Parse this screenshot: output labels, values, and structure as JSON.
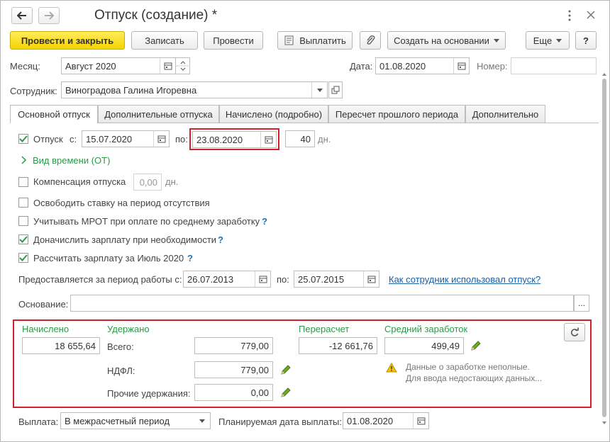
{
  "window": {
    "title": "Отпуск (создание) *",
    "more_icon": "vertical-dots-icon",
    "close_icon": "close-icon"
  },
  "toolbar": {
    "post_close": "Провести и закрыть",
    "save": "Записать",
    "post": "Провести",
    "pay": "Выплатить",
    "create_based": "Создать на основании",
    "more": "Еще",
    "help": "?"
  },
  "header": {
    "month_label": "Месяц:",
    "month_value": "Август 2020",
    "date_label": "Дата:",
    "date_value": "01.08.2020",
    "number_label": "Номер:",
    "number_value": "",
    "employee_label": "Сотрудник:",
    "employee_value": "Виноградова Галина Игоревна"
  },
  "tabs": [
    {
      "label": "Основной отпуск",
      "active": true
    },
    {
      "label": "Дополнительные отпуска",
      "active": false
    },
    {
      "label": "Начислено (подробно)",
      "active": false
    },
    {
      "label": "Пересчет прошлого периода",
      "active": false
    },
    {
      "label": "Дополнительно",
      "active": false
    }
  ],
  "vacation": {
    "label": "Отпуск",
    "from_label": "с:",
    "from_value": "15.07.2020",
    "to_label": "по:",
    "to_value": "23.08.2020",
    "days_value": "40",
    "days_unit": "дн.",
    "checked": true
  },
  "time_type_link": "Вид времени (ОТ)",
  "compensation": {
    "label": "Компенсация отпуска",
    "value": "0,00",
    "unit": "дн.",
    "checked": false
  },
  "options": [
    {
      "label": "Освободить ставку на период отсутствия",
      "checked": false,
      "help": false
    },
    {
      "label": "Учитывать МРОТ при оплате по среднему заработку",
      "checked": false,
      "help": true
    },
    {
      "label": "Доначислить зарплату при необходимости",
      "checked": true,
      "help": true
    },
    {
      "label": "Рассчитать зарплату за Июль 2020",
      "checked": true,
      "help": true
    }
  ],
  "work_period": {
    "label": "Предоставляется за период работы с:",
    "from_value": "26.07.2013",
    "to_label": "по:",
    "to_value": "25.07.2015",
    "link": "Как сотрудник использовал отпуск?"
  },
  "basis": {
    "label": "Основание:",
    "value": "",
    "button": "..."
  },
  "totals": {
    "accrued_label": "Начислено",
    "accrued_value": "18 655,64",
    "withheld_label": "Удержано",
    "total_label": "Всего:",
    "total_value": "779,00",
    "ndfl_label": "НДФЛ:",
    "ndfl_value": "779,00",
    "other_label": "Прочие удержания:",
    "other_value": "0,00",
    "recalc_label": "Перерасчет",
    "recalc_value": "-12 661,76",
    "avg_label": "Средний заработок",
    "avg_value": "499,49",
    "warning_line1": "Данные о заработке неполные.",
    "warning_line2": "Для ввода недостающих данных..."
  },
  "payment": {
    "label": "Выплата:",
    "value": "В межрасчетный период",
    "planned_label": "Планируемая дата выплаты:",
    "planned_value": "01.08.2020"
  },
  "colors": {
    "accent_green": "#2a9a49",
    "highlight_red": "#d1212b",
    "primary_yellow": "#f5d300",
    "link_blue": "#1a5fa8"
  }
}
